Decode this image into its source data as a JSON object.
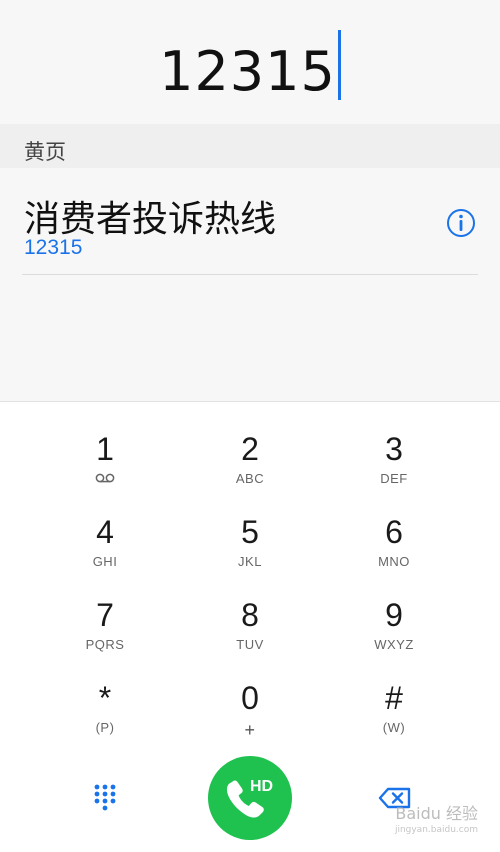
{
  "display": {
    "number": "12315"
  },
  "yellow_pages": {
    "header": "黄页",
    "result": {
      "name": "消费者投诉热线",
      "number": "12315"
    }
  },
  "keypad": {
    "keys": [
      {
        "digit": "1",
        "letters": ""
      },
      {
        "digit": "2",
        "letters": "ABC"
      },
      {
        "digit": "3",
        "letters": "DEF"
      },
      {
        "digit": "4",
        "letters": "GHI"
      },
      {
        "digit": "5",
        "letters": "JKL"
      },
      {
        "digit": "6",
        "letters": "MNO"
      },
      {
        "digit": "7",
        "letters": "PQRS"
      },
      {
        "digit": "8",
        "letters": "TUV"
      },
      {
        "digit": "9",
        "letters": "WXYZ"
      },
      {
        "digit": "*",
        "letters": "(P)"
      },
      {
        "digit": "0",
        "letters": "+"
      },
      {
        "digit": "#",
        "letters": "(W)"
      }
    ]
  },
  "call": {
    "badge": "HD"
  },
  "watermark": {
    "logo": "Baidu 经验",
    "url": "jingyan.baidu.com"
  },
  "colors": {
    "accent": "#1a73e8",
    "call": "#1fc14f",
    "keypad_bg": "#ffffff",
    "page_bg": "#f7f7f8"
  },
  "icons": [
    "voicemail-icon",
    "info-icon",
    "dialpad-icon",
    "phone-icon",
    "backspace-icon"
  ]
}
